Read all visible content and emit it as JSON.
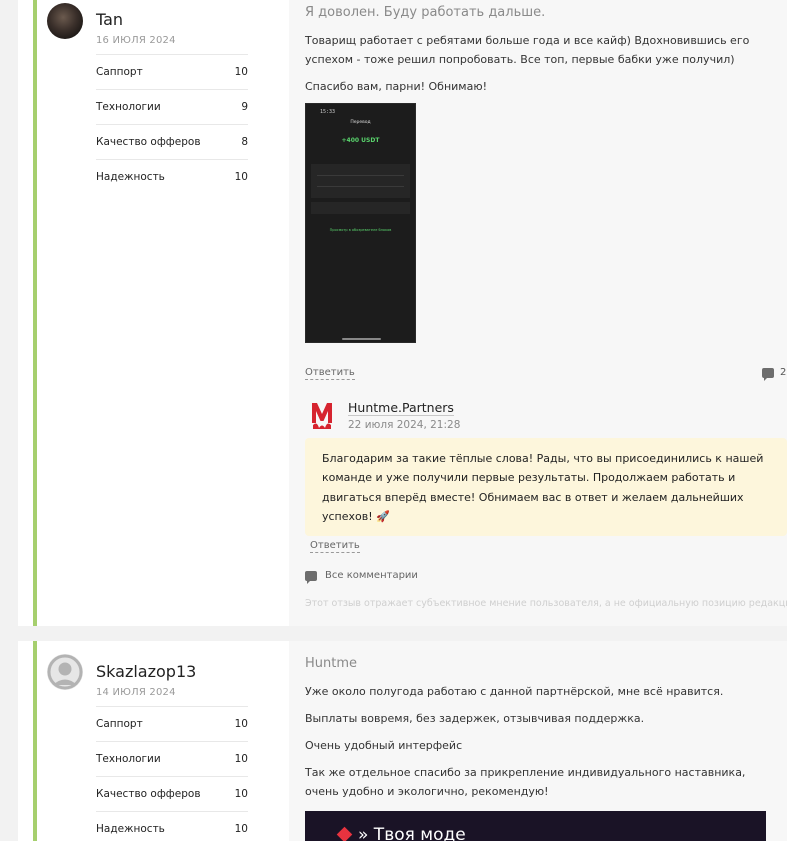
{
  "reviews": [
    {
      "author": "Tan",
      "date": "16 ИЮЛЯ 2024",
      "ratings": [
        {
          "label": "Саппорт",
          "value": "10"
        },
        {
          "label": "Технологии",
          "value": "9"
        },
        {
          "label": "Качество офферов",
          "value": "8"
        },
        {
          "label": "Надежность",
          "value": "10"
        }
      ],
      "title": "Я доволен. Буду работать дальше.",
      "paragraphs": [
        "Товарищ работает с ребятами больше года и все кайф) Вдохновившись его успехом - тоже решил попробовать. Все топ, первые бабки уже получил)",
        "Спасибо вам, парни! Обнимаю!"
      ],
      "screenshot": {
        "time": "15:33",
        "title": "Перевод",
        "amount": "+400 USDT",
        "link": "Просмотр в обозревателе блоков"
      },
      "reply_label": "Ответить",
      "comment_count": "2",
      "reply": {
        "author": "Huntme.Partners",
        "date": "22 июля 2024, 21:28",
        "text": "Благодарим за такие тёплые слова! Рады, что вы присоединились к нашей команде и уже получили первые результаты. Продолжаем работать и двигаться вперёд вместе! Обнимаем вас в ответ и желаем дальнейших успехов! 🚀",
        "reply_label": "Ответить"
      },
      "all_comments_label": "Все комментарии",
      "disclaimer": "Этот отзыв отражает субъективное мнение пользователя, а не официальную позицию редакции."
    },
    {
      "author": "Skazlazop13",
      "date": "14 ИЮЛЯ 2024",
      "ratings": [
        {
          "label": "Саппорт",
          "value": "10"
        },
        {
          "label": "Технологии",
          "value": "10"
        },
        {
          "label": "Качество офферов",
          "value": "10"
        },
        {
          "label": "Надежность",
          "value": "10"
        }
      ],
      "title": "Huntme",
      "paragraphs": [
        "Уже около полугода работаю с данной партнёрской, мне всё нравится.",
        "Выплаты вовремя, без задержек, отзывчивая поддержка.",
        "Очень удобный интерфейс",
        "Так же отдельное спасибо за прикрепление индивидуального наставника, очень удобно и экологично, рекомендую!"
      ],
      "promo_text": "» Твоя моде"
    }
  ],
  "colors": {
    "accent_bar": "#a6cf6e",
    "reply_bg": "#fdf6dc",
    "brand_red": "#e8333f"
  }
}
